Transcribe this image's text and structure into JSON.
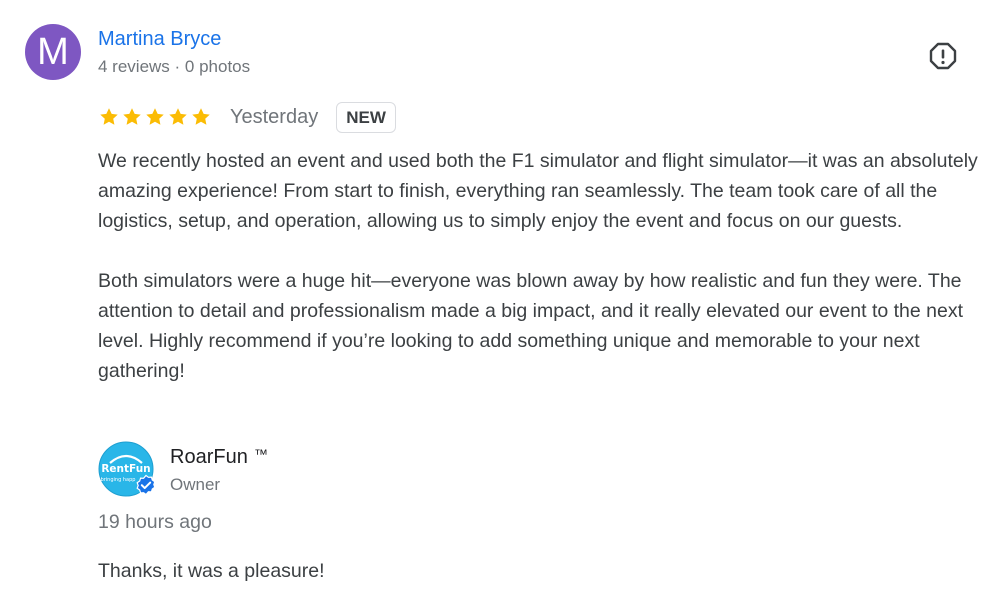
{
  "review": {
    "avatar_letter": "M",
    "avatar_color": "#7e57c2",
    "reviewer_name": "Martina Bryce",
    "reviewer_meta": "4 reviews · 0 photos",
    "report_icon": "report-flag-icon",
    "rating": 5,
    "rating_max": 5,
    "star_color": "#fbbc04",
    "date": "Yesterday",
    "badge": "NEW",
    "paragraphs": [
      "We recently hosted an event and used both the F1 simulator and flight simulator—it was an absolutely amazing experience! From start to finish, everything ran seamlessly. The team took care of all the logistics, setup, and operation, allowing us to simply enjoy the event and focus on our guests.",
      "Both simulators were a huge hit—everyone was blown away by how realistic and fun they were. The attention to detail and professionalism made a big impact, and it really elevated our event to the next level. Highly recommend if you’re looking to add something unique and memorable to your next gathering!"
    ]
  },
  "owner_reply": {
    "logo_text": "RentFun",
    "logo_subtext": "bringing happ",
    "owner_name": "RoarFun",
    "trademark": "™",
    "role": "Owner",
    "time": "19 hours ago",
    "text": "Thanks, it was a pleasure!",
    "verified_icon": "verified-check-icon"
  },
  "colors": {
    "link_blue": "#1a73e8",
    "text_primary": "#3c4043",
    "text_secondary": "#70757a",
    "logo_cyan": "#29b6e8",
    "verified_blue": "#1a73e8"
  }
}
